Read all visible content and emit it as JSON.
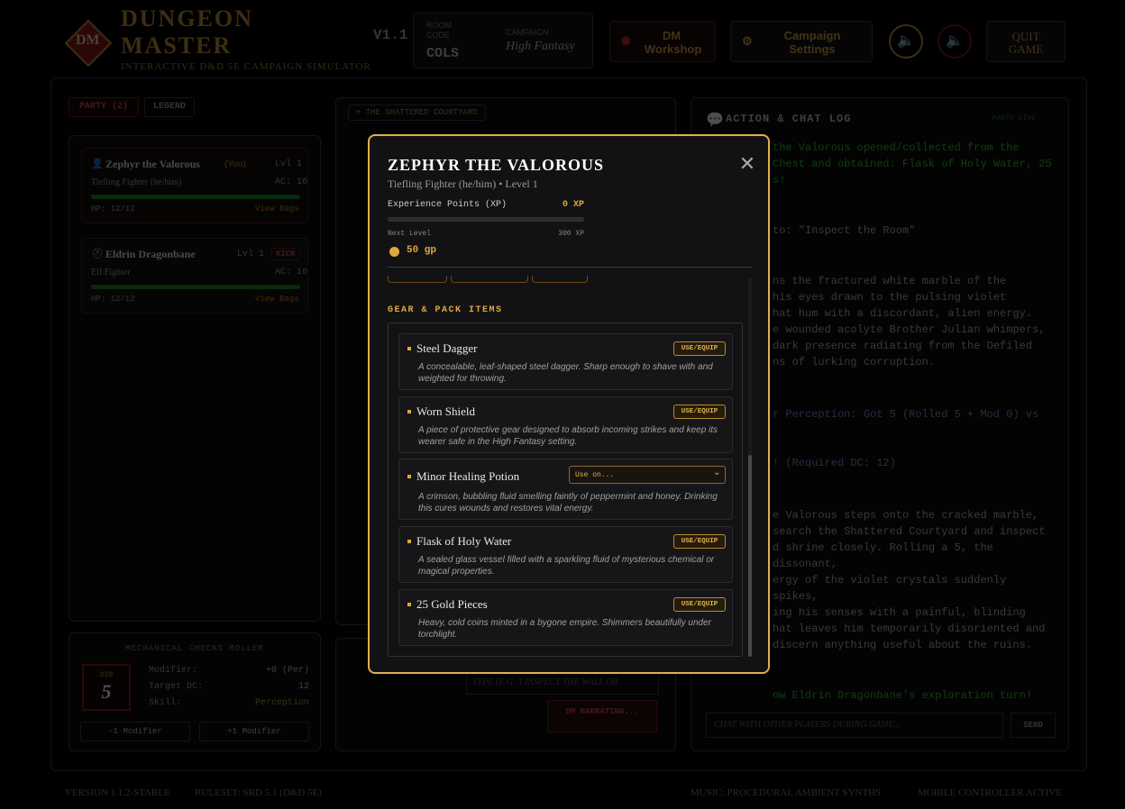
{
  "header": {
    "logo_text": "DM",
    "title_line1": "DUNGEON",
    "title_line2": "MASTER",
    "subtitle": "INTERACTIVE D&D 5E CAMPAIGN SIMULATOR",
    "version": "V1.1",
    "room_code_label": "ROOM CODE",
    "room_code": "COLS",
    "campaign_label": "CAMPAIGN",
    "campaign": "High Fantasy",
    "dm_workshop": "DM Workshop",
    "campaign_settings": "Campaign Settings",
    "quit_game": "QUIT GAME"
  },
  "party": {
    "tab_party": "PARTY (2)",
    "tab_legend": "LEGEND",
    "members": [
      {
        "name": "Zephyr the Valorous",
        "you": "(You)",
        "level": "Lvl 1",
        "class": "Tiefling Fighter (he/him)",
        "ac": "AC: 16",
        "hp": "HP: 12/12",
        "bags": "View Bags",
        "hp_fraction": 1.0
      },
      {
        "name": "Eldrin Dragonbane",
        "level": "Lvl 1",
        "kick": "KICK",
        "class": "Elf Fighter",
        "ac": "AC: 16",
        "hp": "HP: 12/12",
        "bags": "View Bags",
        "hp_fraction": 1.0
      }
    ]
  },
  "roller": {
    "title": "MECHANICAL CHECKS ROLLER",
    "die": "D20",
    "die_value": "5",
    "modifier_label": "Modifier:",
    "modifier_value": "+0 (Per)",
    "dc_label": "Target DC:",
    "dc_value": "12",
    "skill_label": "Skill:",
    "skill_value": "Perception",
    "minus_btn": "-1 Modifier",
    "plus_btn": "+1 Modifier"
  },
  "map": {
    "location": "THE SHATTERED COURTYARD",
    "action_placeholder": "TYPE (E.G. 'I INSPECT THE WALL OR",
    "narrating": "DM NARRATING..."
  },
  "log": {
    "title": "ACTION & CHAT LOG",
    "party_live": "PARTY LIVE",
    "entries": [
      "the Valorous opened/collected from the",
      "Chest and obtained: Flask of Holy Water, 25",
      "s!",
      "to: \"Inspect the Room\"",
      "ns the fractured white marble of the",
      "his eyes drawn to the pulsing violet",
      "hat hum with a discordant, alien energy.",
      "e wounded acolyte Brother Julian whimpers,",
      "dark presence radiating from the Defiled",
      "ns of lurking corruption.",
      "r Perception: Got 5 (Rolled 5 + Mod 0) vs",
      "! (Required DC: 12)",
      "e Valorous steps onto the cracked marble,",
      "search the Shattered Courtyard and inspect",
      "d shrine closely. Rolling a 5, the dissonant,",
      "ergy of the violet crystals suddenly spikes,",
      "ing his senses with a painful, blinding",
      "hat leaves him temporarily disoriented and",
      "discern anything useful about the ruins.",
      "ow Eldrin Dragonbane's exploration turn!"
    ],
    "chat_placeholder": "CHAT WITH OTHER PLAYERS DURING GAME...",
    "send": "SEND"
  },
  "footer": {
    "version": "VERSION 1.1.2-STABLE",
    "ruleset": "RULESET: SRD 5.1 (D&D 5E)",
    "music": "MUSIC: PROCEDURAL AMBIENT SYNTHS",
    "mobile": "MOBILE CONTROLLER ACTIVE"
  },
  "modal": {
    "name": "ZEPHYR THE VALOROUS",
    "subtitle": "Tiefling Fighter (he/him) • Level 1",
    "xp_label": "Experience Points (XP)",
    "xp_value": "0 XP",
    "xp_fraction": 0.0,
    "next_level_label": "Next Level",
    "next_level_value": "300 XP",
    "gold": "50 gp",
    "section_title": "GEAR & PACK ITEMS",
    "items": [
      {
        "name": "Steel Dagger",
        "desc": "A concealable, leaf-shaped steel dagger. Sharp enough to shave with and weighted for throwing.",
        "action": "USE/EQUIP"
      },
      {
        "name": "Worn Shield",
        "desc": "A piece of protective gear designed to absorb incoming strikes and keep its wearer safe in the High Fantasy setting.",
        "action": "USE/EQUIP"
      },
      {
        "name": "Minor Healing Potion",
        "desc": "A crimson, bubbling fluid smelling faintly of peppermint and honey. Drinking this cures wounds and restores vital energy.",
        "select": "Use on..."
      },
      {
        "name": "Flask of Holy Water",
        "desc": "A sealed glass vessel filled with a sparkling fluid of mysterious chemical or magical properties.",
        "action": "USE/EQUIP"
      },
      {
        "name": "25 Gold Pieces",
        "desc": "Heavy, cold coins minted in a bygone empire. Shimmers beautifully under torchlight.",
        "action": "USE/EQUIP"
      }
    ]
  }
}
